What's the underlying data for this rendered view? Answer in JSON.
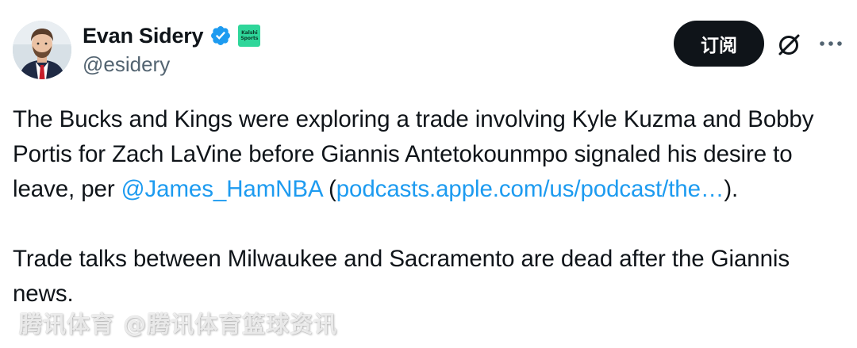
{
  "author": {
    "display_name": "Evan Sidery",
    "handle": "@esidery",
    "verified_icon": "verified-badge-icon",
    "affiliate_badge_line1": "Kalshi",
    "affiliate_badge_line2": "Sports",
    "affiliate_badge_color": "#2fd69a"
  },
  "actions": {
    "subscribe_label": "订阅",
    "grok_icon": "grok-icon",
    "more_icon": "more-options-icon"
  },
  "tweet": {
    "para1_text1": "The Bucks and Kings were exploring a trade involving Kyle Kuzma and Bobby Portis for Zach LaVine before Giannis Antetokounmpo signaled his desire to leave, per ",
    "mention": "@James_HamNBA",
    "para1_text2": " (",
    "link_text": "podcasts.apple.com/us/podcast/the…",
    "para1_text3": ").",
    "para2_text": "Trade talks between Milwaukee and Sacramento are dead after the Giannis news."
  },
  "watermark": "腾讯体育 @腾讯体育篮球资讯",
  "colors": {
    "link": "#1d9bf0",
    "text": "#0f1419",
    "secondary": "#536471",
    "button_bg": "#0f1419"
  }
}
